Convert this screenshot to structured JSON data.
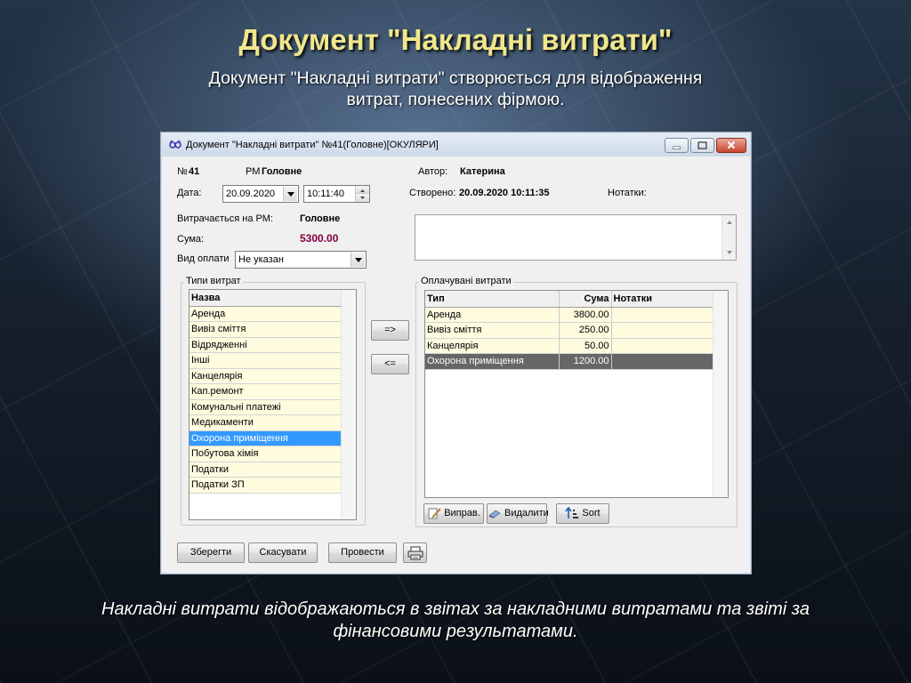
{
  "slide": {
    "title": "Документ \"Накладні витрати\"",
    "subtitle": "Документ \"Накладні витрати\" створюється для відображення витрат, понесених фірмою.",
    "footer": "Накладні витрати відображаються в звітах за накладними витратами та звіті за фінансовими результатами."
  },
  "window": {
    "title": "Документ \"Накладні витрати\" №41(Головне)[ОКУЛЯРИ]",
    "icon": "glasses-icon"
  },
  "header": {
    "number_label": "№",
    "number_value": "41",
    "rm_label": "РМ",
    "rm_value": "Головне",
    "author_label": "Автор:",
    "author_value": "Катерина",
    "date_label": "Дата:",
    "date_value": "20.09.2020",
    "time_value": "10:11:40",
    "created_label": "Створено:",
    "created_value": "20.09.2020 10:11:35",
    "notes_label": "Нотатки:",
    "spent_on_label": "Витрачається на РМ:",
    "spent_on_value": "Головне",
    "sum_label": "Сума:",
    "sum_value": "5300.00",
    "sum_color": "#800040",
    "payment_label": "Вид оплати",
    "payment_value": "Не указан"
  },
  "types_panel": {
    "group_label": "Типи витрат",
    "column": "Назва",
    "items": [
      "Аренда",
      "Вивіз сміття",
      "Відрядженні",
      "Інші",
      "Канцелярія",
      "Кап.ремонт",
      "Комунальні платежі",
      "Медикаменти",
      "Охорона приміщення",
      "Побутова хімія",
      "Податки",
      "Податки ЗП"
    ],
    "selected_index": 8
  },
  "transfer": {
    "add_label": "=>",
    "remove_label": "<="
  },
  "paid_panel": {
    "group_label": "Оплачувані витрати",
    "columns": [
      "Тип",
      "Сума",
      "Нотатки"
    ],
    "rows": [
      {
        "type": "Аренда",
        "sum": "3800.00",
        "notes": ""
      },
      {
        "type": "Вивіз сміття",
        "sum": "250.00",
        "notes": ""
      },
      {
        "type": "Канцелярія",
        "sum": "50.00",
        "notes": ""
      },
      {
        "type": "Охорона приміщення",
        "sum": "1200.00",
        "notes": ""
      }
    ],
    "selected_index": 3,
    "edit_label": "Виправ.",
    "delete_label": "Видалити",
    "sort_label": "Sort"
  },
  "footer_buttons": {
    "save": "Зберегти",
    "cancel": "Скасувати",
    "post": "Провести",
    "print_icon": "printer-icon"
  }
}
